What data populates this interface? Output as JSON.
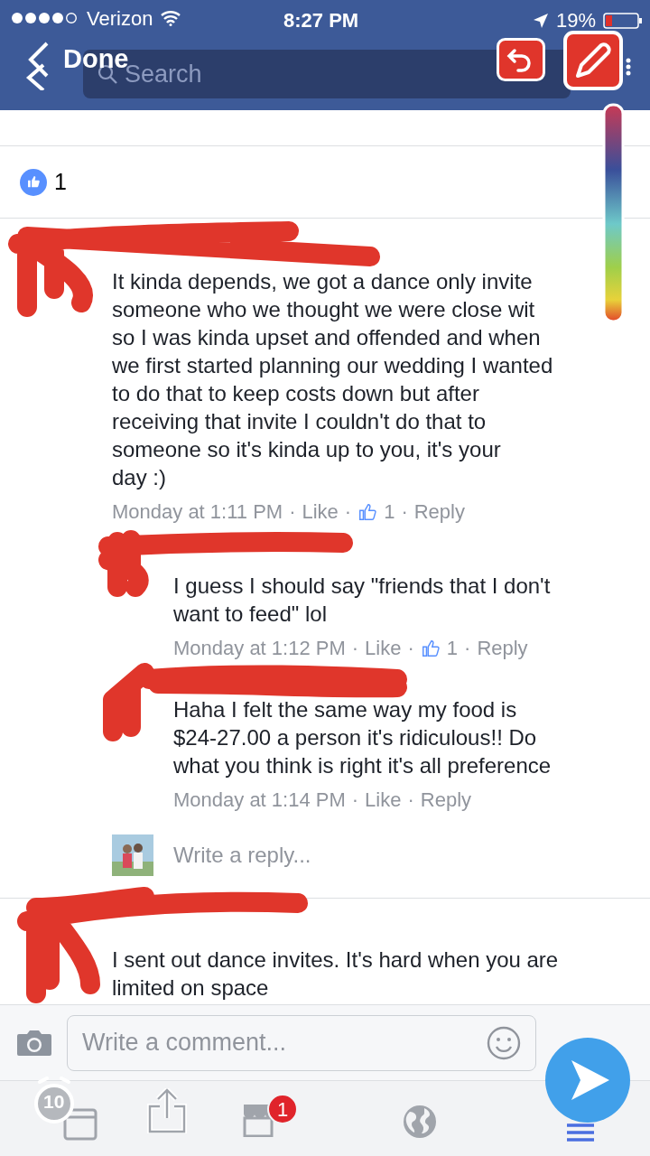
{
  "status_bar": {
    "carrier": "Verizon",
    "time": "8:27 PM",
    "battery": "19%"
  },
  "header": {
    "back_label": "Done",
    "search_placeholder": "Search"
  },
  "reactions": {
    "count": "1"
  },
  "comments": [
    {
      "text": "It kinda depends, we got a dance only invite\nsomeone who we thought we were close wit\nso I was kinda upset and offended and when\nwe first started planning our wedding I wanted\nto do that to keep costs down but after\nreceiving that invite I couldn't do that to\nsomeone so it's kinda up to you, it's your\nday :)",
      "time": "Monday at 1:11 PM",
      "separator": "·",
      "like": "Like",
      "likes": "1",
      "reply": "Reply",
      "replies": [
        {
          "text": "I guess I should say \"friends that I don't\nwant to feed\" lol",
          "time": "Monday at 1:12 PM",
          "separator": "·",
          "like": "Like",
          "likes": "1",
          "reply": "Reply"
        },
        {
          "text": "Haha I felt the same way my food is\n$24-27.00 a person it's ridiculous!! Do\nwhat you think is right it's all preference",
          "time": "Monday at 1:14 PM",
          "separator": "·",
          "like": "Like",
          "reply": "Reply"
        }
      ],
      "reply_placeholder": "Write a reply..."
    },
    {
      "text": "I sent out dance invites. It's hard when you are\nlimited on space"
    }
  ],
  "composer": {
    "placeholder": "Write a comment..."
  },
  "tab_bar": [
    {
      "kind": "tabs"
    },
    {
      "kind": "share"
    },
    {
      "kind": "store",
      "badge": "1"
    },
    {
      "kind": "globe"
    },
    {
      "kind": "menu",
      "selected": true
    }
  ],
  "markup": {
    "timer": "10"
  }
}
